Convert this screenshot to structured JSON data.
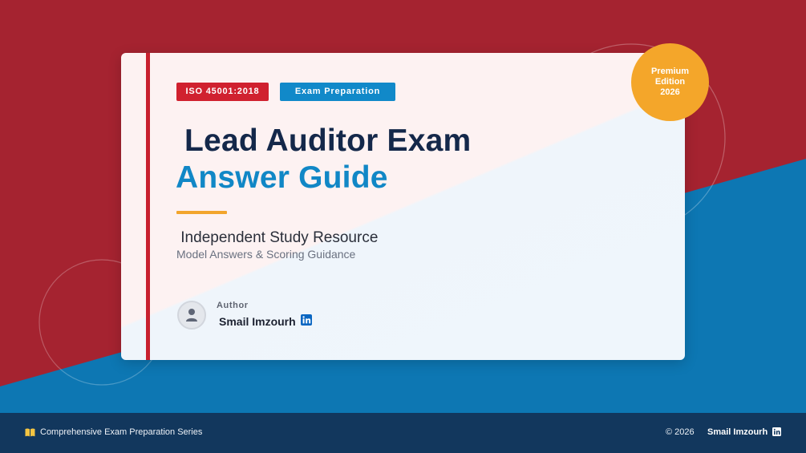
{
  "colors": {
    "brand_red": "#a52330",
    "brand_blue": "#0d77b3",
    "accent_red": "#d0212f",
    "accent_blue": "#1189c9",
    "accent_orange": "#f4a62a",
    "navy": "#14284a",
    "footer_bg": "#12375d"
  },
  "card": {
    "tags": {
      "iso": "ISO 45001:2018",
      "exam": "Exam Preparation"
    },
    "title_line1": " Lead Auditor Exam",
    "title_line2": "Answer Guide",
    "subtitle": " Independent Study Resource",
    "description": "Model Answers & Scoring Guidance",
    "author": {
      "label": "Author",
      "name": "Smail Imzourh",
      "avatar_icon": "user-icon",
      "social_icon": "linkedin-icon"
    }
  },
  "badge": {
    "line1": "Premium",
    "line2": "Edition",
    "line3": "2026"
  },
  "footer": {
    "icon": "book-icon",
    "series": "Comprehensive Exam Preparation Series",
    "copyright": "© 2026",
    "name": "Smail Imzourh",
    "social_icon": "linkedin-icon"
  }
}
